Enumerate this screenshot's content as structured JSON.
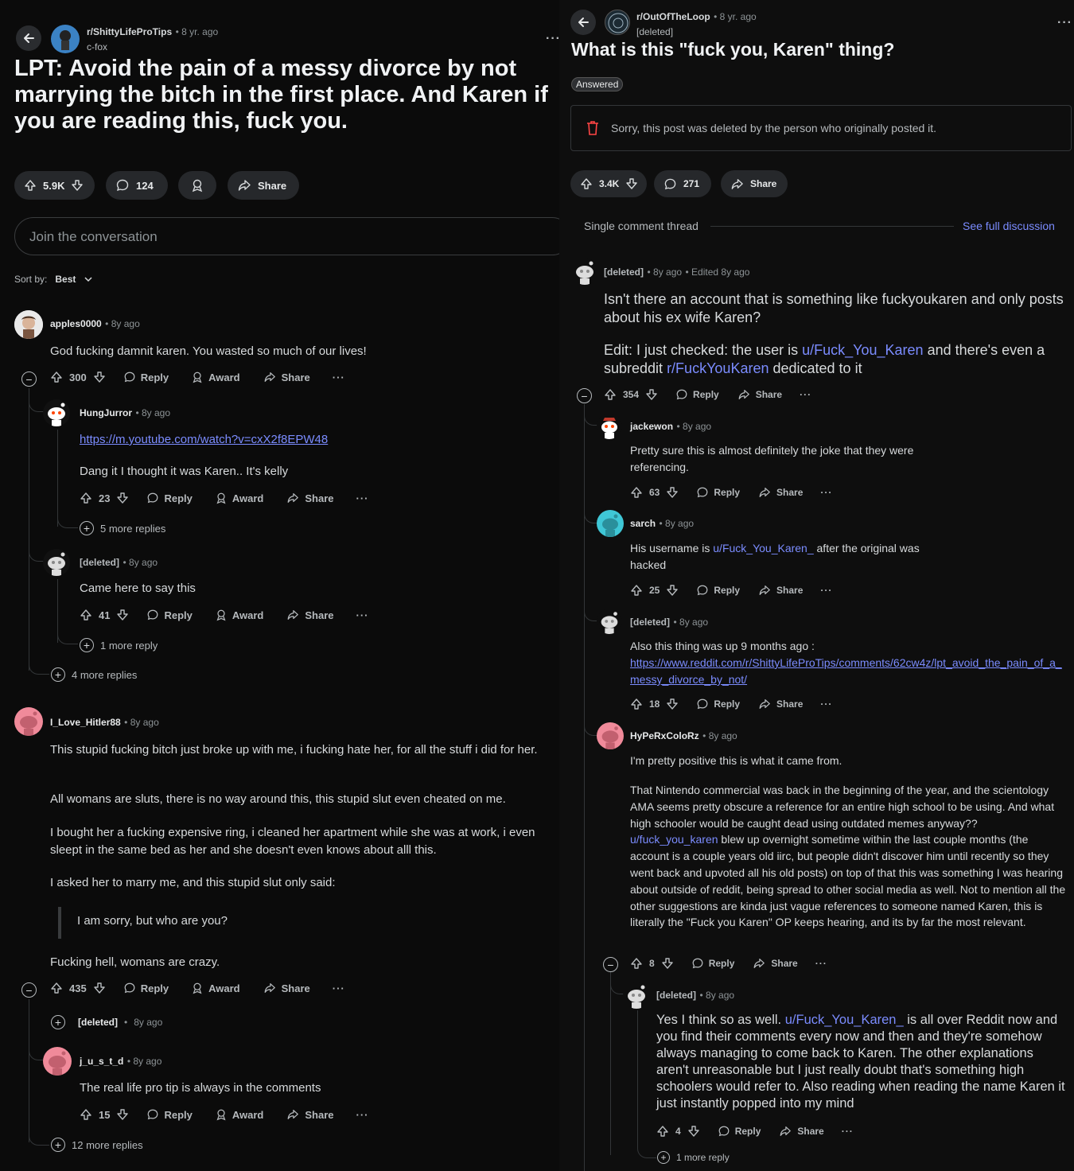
{
  "left": {
    "subreddit": "r/ShittyLifeProTips",
    "age": "8 yr. ago",
    "author": "c-fox",
    "title": "LPT: Avoid the pain of a messy divorce by not marrying the bitch in the first place. And Karen if you are reading this, fuck you.",
    "votes": "5.9K",
    "comments": "124",
    "share": "Share",
    "join_placeholder": "Join the conversation",
    "sort_label": "Sort by:",
    "sort_value": "Best",
    "c1": {
      "user": "apples0000",
      "age": "8y ago",
      "text": "God fucking damnit karen. You wasted so much of our lives!",
      "votes": "300"
    },
    "c1r1": {
      "user": "HungJurror",
      "age": "8y ago",
      "link": "https://m.youtube.com/watch?v=cxX2f8EPW48",
      "text": "Dang it I thought it was Karen.. It's kelly",
      "votes": "23",
      "more": "5 more replies"
    },
    "c1r2": {
      "user": "[deleted]",
      "age": "8y ago",
      "text": "Came here to say this",
      "votes": "41",
      "more": "1 more reply"
    },
    "c1_more": "4 more replies",
    "c2": {
      "user": "I_Love_Hitler88",
      "age": "8y ago",
      "p1": "This stupid fucking bitch just broke up with me, i fucking hate her, for all the stuff i did for her.",
      "p2": "All womans are sluts, there is no way around this, this stupid slut even cheated on me.",
      "p3": "I bought her a fucking expensive ring, i cleaned her apartment while she was at work, i even sleept in the same bed as her and she doesn't even knows about alll this.",
      "p4": "I asked her to marry me, and this stupid slut only said:",
      "quote": "I am sorry, but who are you?",
      "p5": "Fucking hell, womans are crazy.",
      "votes": "435"
    },
    "c2r1": {
      "user": "[deleted]",
      "age": "8y ago"
    },
    "c2r2": {
      "user": "j_u_s_t_d",
      "age": "8y ago",
      "text": "The real life pro tip is always in the comments",
      "votes": "15"
    },
    "c2_more": "12 more replies",
    "labels": {
      "reply": "Reply",
      "award": "Award",
      "share": "Share"
    }
  },
  "right": {
    "subreddit": "r/OutOfTheLoop",
    "age": "8 yr. ago",
    "author": "[deleted]",
    "title": "What is this \"fuck you, Karen\" thing?",
    "flair": "Answered",
    "deleted_notice": "Sorry, this post was deleted by the person who originally posted it.",
    "votes": "3.4K",
    "comments": "271",
    "share": "Share",
    "thread_label": "Single comment thread",
    "full_discussion": "See full discussion",
    "c1": {
      "user": "[deleted]",
      "age": "8y ago",
      "edited": "Edited 8y ago",
      "p1": "Isn't there an account that is something like fuckyoukaren and only posts about his ex wife Karen?",
      "p2a": "Edit: I just checked: the user is ",
      "p2_link": "u/Fuck_You_Karen",
      "p2b": " and there's even a subreddit ",
      "p2_link2": "r/FuckYouKaren",
      "p2c": " dedicated to it",
      "votes": "354"
    },
    "r1": {
      "user": "jackewon",
      "age": "8y ago",
      "text": "Pretty sure this is almost definitely the joke that they were referencing.",
      "votes": "63"
    },
    "r2": {
      "user": "sarch",
      "age": "8y ago",
      "text_a": "His username is ",
      "link": "u/Fuck_You_Karen_",
      "text_b": " after the original was hacked",
      "votes": "25"
    },
    "r3": {
      "user": "[deleted]",
      "age": "8y ago",
      "text": "Also this thing was up 9 months ago :",
      "link": "https://www.reddit.com/r/ShittyLifeProTips/comments/62cw4z/lpt_avoid_the_pain_of_a_messy_divorce_by_not/",
      "votes": "18"
    },
    "r4": {
      "user": "HyPeRxColoRz",
      "age": "8y ago",
      "p1": "I'm pretty positive this is what it came from.",
      "p2a": "That Nintendo commercial was back in the beginning of the year, and the scientology AMA seems pretty obscure a reference for an entire high school to be using. And what high schooler would be caught dead using outdated memes anyway?? ",
      "p2_link": "u/fuck_you_karen",
      "p2b": " blew up overnight sometime within the last couple months (the account is a couple years old iirc, but people didn't discover him until recently so they went back and upvoted all his old posts) on top of that this was something I was hearing about outside of reddit, being spread to other social media as well. Not to mention all the other suggestions are kinda just vague references to someone named Karen, this is literally the \"Fuck you Karen\" OP keeps hearing, and its by far the most relevant.",
      "votes": "8"
    },
    "r4r1": {
      "user": "[deleted]",
      "age": "8y ago",
      "text_a": "Yes I think so as well. ",
      "link": "u/Fuck_You_Karen_",
      "text_b": " is all over Reddit now and you find their comments every now and then and they're somehow always managing to come back to Karen. The other explanations aren't unreasonable but I just really doubt that's something high schoolers would refer to. Also reading when reading the name Karen it just instantly popped into my mind",
      "votes": "4",
      "more": "1 more reply"
    },
    "labels": {
      "reply": "Reply",
      "share": "Share"
    }
  }
}
